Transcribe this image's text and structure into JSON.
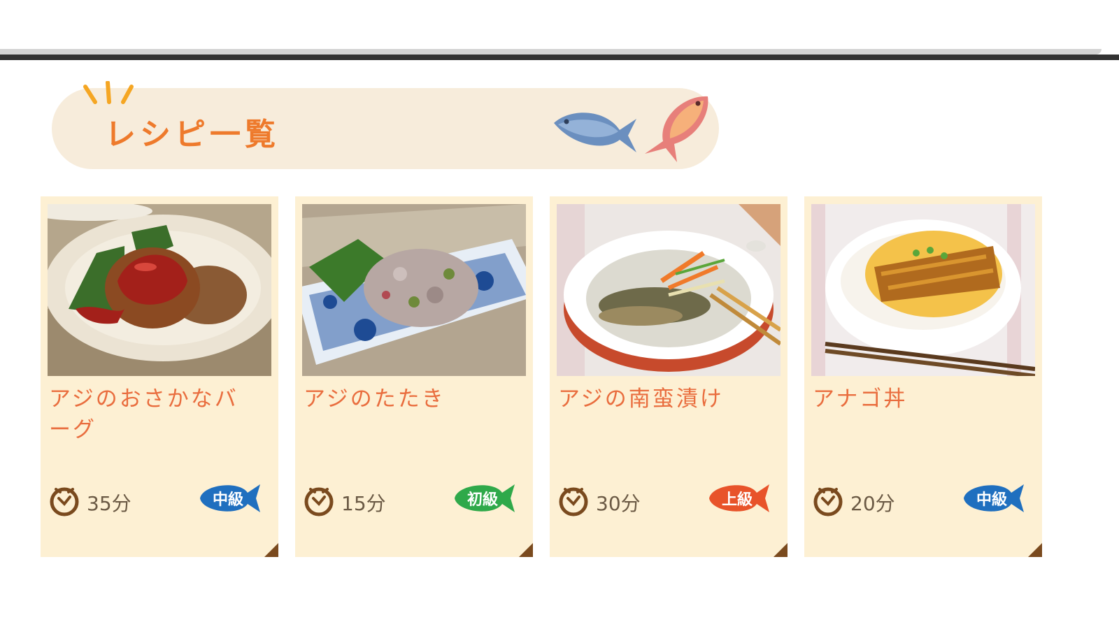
{
  "section": {
    "title": "レシピ一覧",
    "icons": [
      "sparkle-icon",
      "blue-fish-icon",
      "pink-fish-icon"
    ]
  },
  "colors": {
    "header_bg": "#f7ecdb",
    "title": "#ee7a2c",
    "card_bg": "#fdf0d3",
    "recipe_name": "#e96d3e",
    "time_text": "#6b5a45",
    "level_intermediate": "#1f6fbf",
    "level_beginner": "#2fa94a",
    "level_advanced": "#e8532a"
  },
  "recipes": [
    {
      "name": "アジのおさかなバーグ",
      "time": "35分",
      "level": "中級",
      "level_color": "#1f6fbf",
      "icon": "clock-icon"
    },
    {
      "name": "アジのたたき",
      "time": "15分",
      "level": "初級",
      "level_color": "#2fa94a",
      "icon": "clock-icon"
    },
    {
      "name": "アジの南蛮漬け",
      "time": "30分",
      "level": "上級",
      "level_color": "#e8532a",
      "icon": "clock-icon"
    },
    {
      "name": "アナゴ丼",
      "time": "20分",
      "level": "中級",
      "level_color": "#1f6fbf",
      "icon": "clock-icon"
    }
  ]
}
